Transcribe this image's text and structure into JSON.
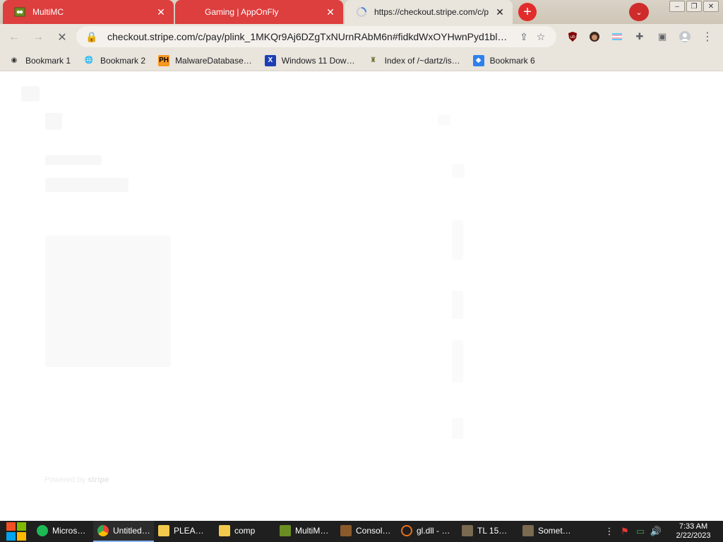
{
  "tabs": [
    {
      "title": "MultiMC",
      "state": "inactive"
    },
    {
      "title": "Gaming | AppOnFly",
      "state": "inactive"
    },
    {
      "title": "https://checkout.stripe.com/c/p",
      "state": "active"
    }
  ],
  "window": {
    "minimize": "–",
    "restore": "❐",
    "close": "✕"
  },
  "toolbar": {
    "url": "checkout.stripe.com/c/pay/plink_1MKQr9Aj6DZgTxNUrnRAbM6n#fidkdWxOYHwnPyd1bl…"
  },
  "bookmarks": [
    {
      "label": "Bookmark 1",
      "icon": "gamepad-icon"
    },
    {
      "label": "Bookmark 2",
      "icon": "globe-icon"
    },
    {
      "label": "MalwareDatabase…",
      "icon": "ph-icon"
    },
    {
      "label": "Windows 11 Dow…",
      "icon": "x-icon"
    },
    {
      "label": "Index of /~dartz/is…",
      "icon": "robot-icon"
    },
    {
      "label": "Bookmark 6",
      "icon": "doc-icon"
    }
  ],
  "page": {
    "powered_prefix": "Powered by",
    "powered_brand": "stripe"
  },
  "taskbar": {
    "items": [
      {
        "label": "Micros…",
        "color": "#1db954"
      },
      {
        "label": "Untitled…",
        "color": "#4285f4"
      },
      {
        "label": "PLEA…",
        "color": "#f2c94c"
      },
      {
        "label": "comp",
        "color": "#f2c94c"
      },
      {
        "label": "MultiM…",
        "color": "#6b8e23"
      },
      {
        "label": "Consol…",
        "color": "#8b5a2b"
      },
      {
        "label": "gl.dll - …",
        "color": "#e8711a"
      },
      {
        "label": "TL 15…",
        "color": "#7a6a4f"
      },
      {
        "label": "Somet…",
        "color": "#7a6a4f"
      }
    ],
    "time": "7:33 AM",
    "date": "2/22/2023"
  },
  "colors": {
    "tab_red": "#dd3e3e",
    "chrome_bg": "#e9e4dc",
    "taskbar": "#1f1f1f"
  }
}
